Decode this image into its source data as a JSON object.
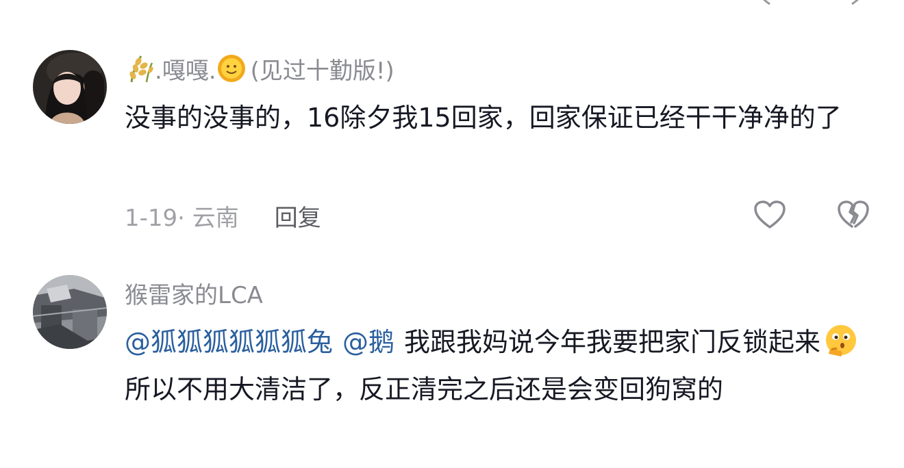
{
  "comments": [
    {
      "username_prefix": ".嘎嘎.",
      "badge": "(见过十勤版!)",
      "text": "没事的没事的，16除夕我15回家，回家保证已经干干净净的了",
      "time_location": "1-19· 云南",
      "reply_label": "回复"
    },
    {
      "username": "猴雷家的LCA",
      "mention_1": "@狐狐狐狐狐狐兔",
      "mention_2": "@鹅",
      "text_part_1": "我跟我妈说今年我要把家门反锁起来",
      "text_part_2": "所以不用大清洁了，反正清完之后还是会变回狗窝的"
    }
  ],
  "icons": {
    "username_emoji_1": "rice-ear-icon",
    "username_emoji_2": "sun-face-icon",
    "like": "heart-outline-icon",
    "dislike": "broken-heart-icon",
    "inline_emoji": "thinking-face-emoji"
  },
  "colors": {
    "text_primary": "#161823",
    "text_secondary": "#8a8b91",
    "mention": "#2b5f9e"
  }
}
